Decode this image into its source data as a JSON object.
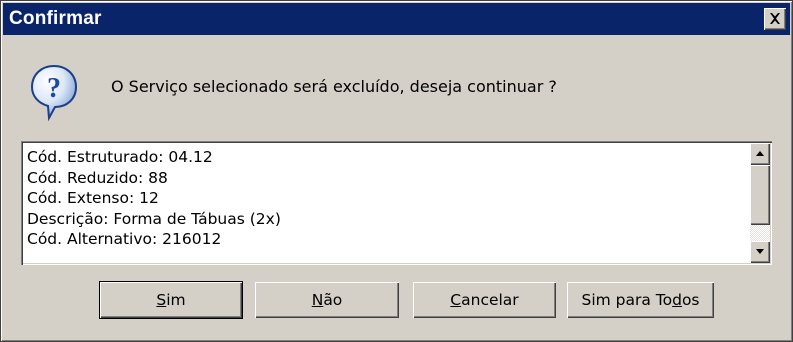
{
  "window": {
    "title": "Confirmar",
    "close_symbol": "×"
  },
  "message": {
    "icon": "question-icon",
    "text": "O Serviço selecionado será excluído, deseja continuar ?"
  },
  "details": {
    "lines": [
      "Cód. Estruturado: 04.12",
      "Cód. Reduzido: 88",
      "Cód. Extenso: 12",
      "Descrição: Forma de Tábuas (2x)",
      "Cód. Alternativo: 216012"
    ]
  },
  "buttons": {
    "sim": {
      "pre": "",
      "accel": "S",
      "post": "im"
    },
    "nao": {
      "pre": "",
      "accel": "N",
      "post": "ão"
    },
    "cancelar": {
      "pre": "",
      "accel": "C",
      "post": "ancelar"
    },
    "sim_todos": {
      "pre": "Sim para To",
      "accel": "d",
      "post": "os"
    }
  },
  "colors": {
    "titlebar": "#0a246a",
    "dialog_face": "#d4d0c8",
    "icon_bubble": "#2f5fb8"
  }
}
